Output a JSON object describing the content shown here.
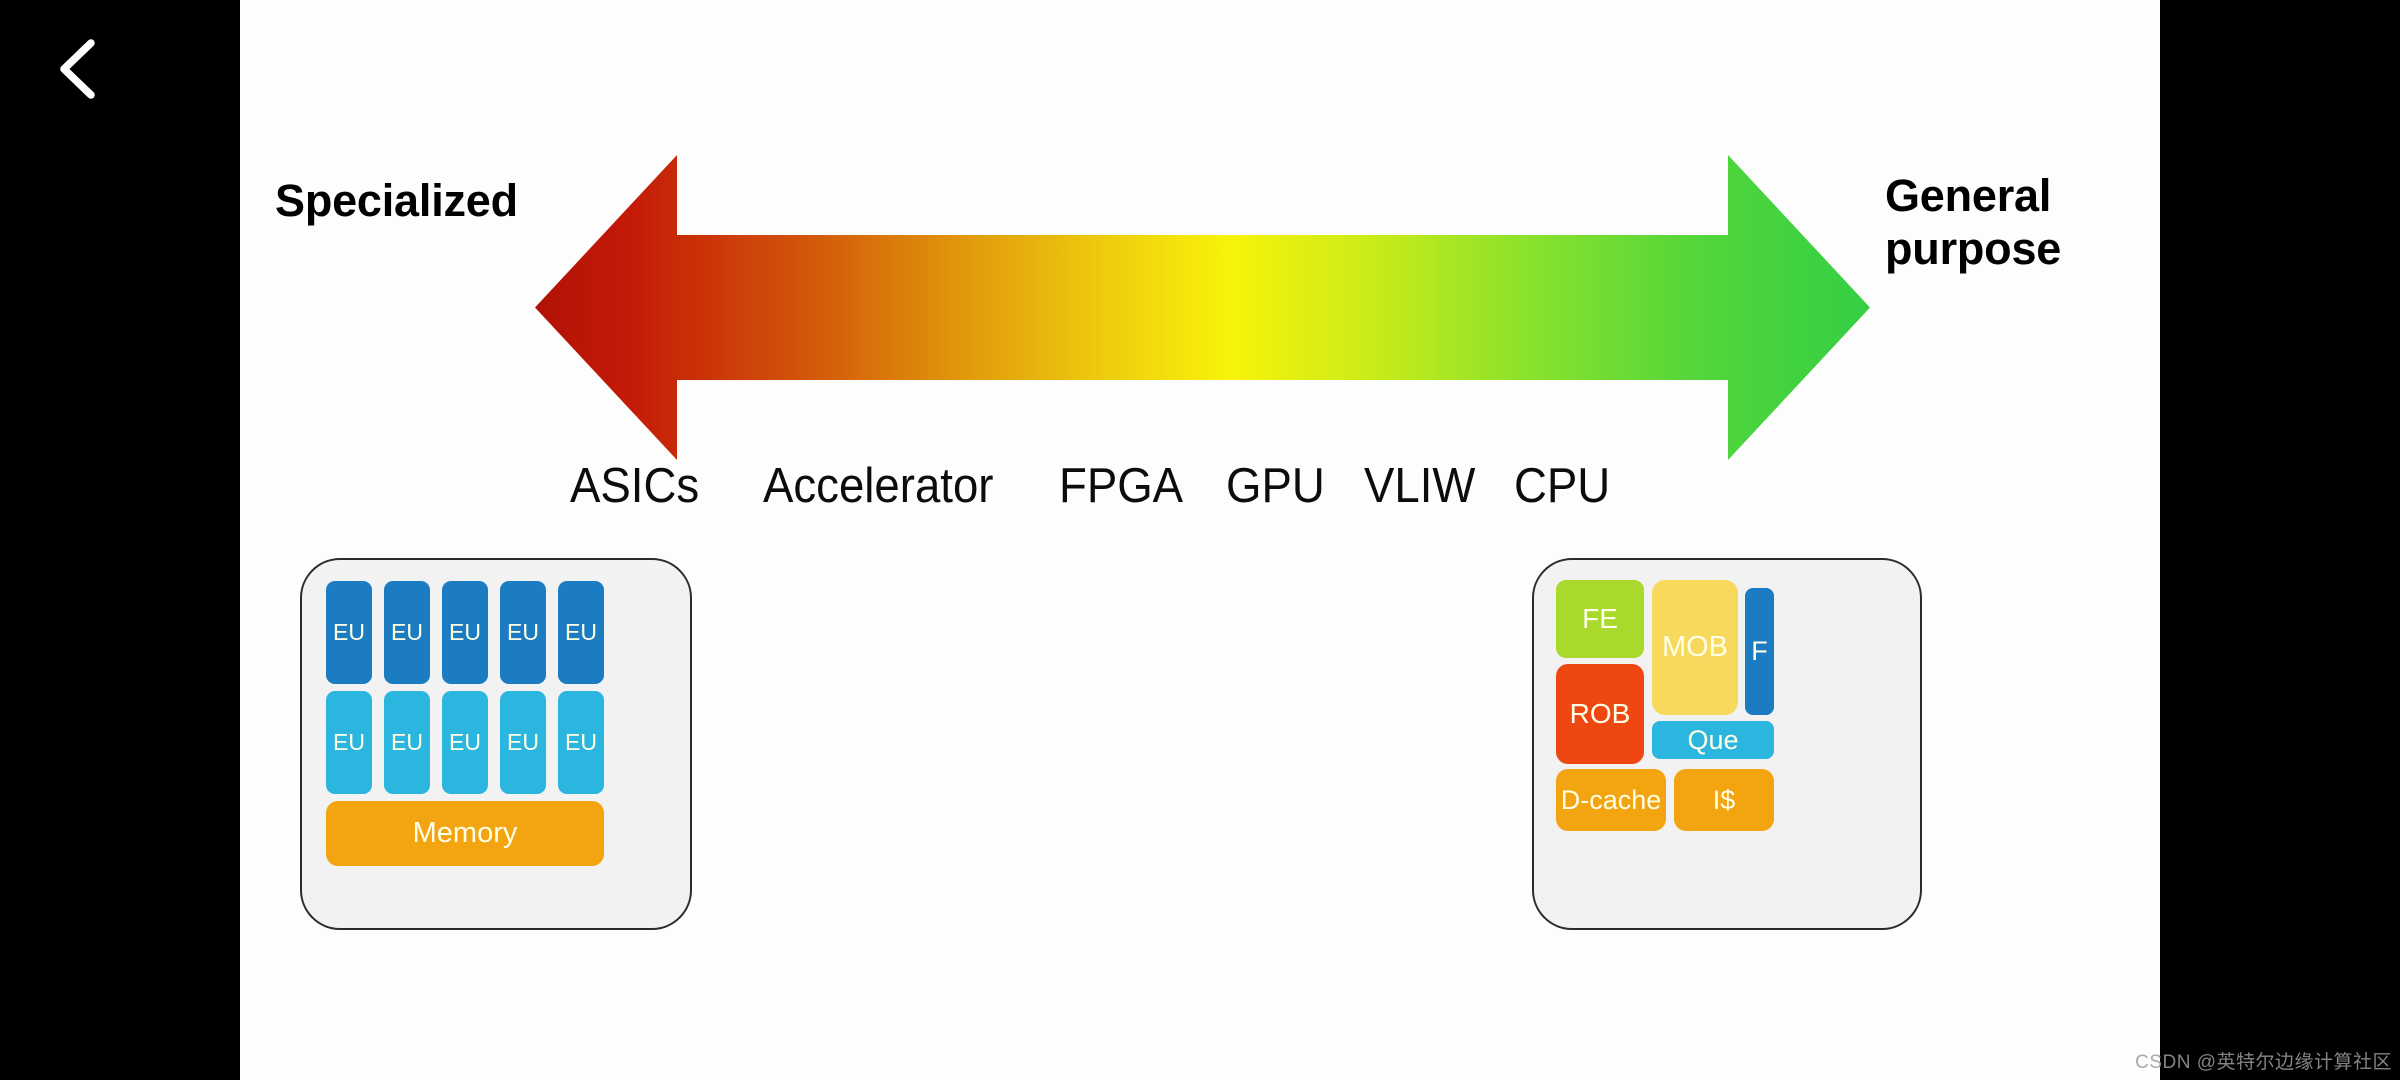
{
  "player": {
    "back_icon": "chevron-left-icon"
  },
  "slide": {
    "axis": {
      "left_label": "Specialized",
      "right_label": "General\npurpose",
      "right_label_line1": "General",
      "right_label_line2": "purpose",
      "arrow_icon": "double-headed-arrow-icon",
      "gradient_stops": [
        "#b01205",
        "#c91f06",
        "#d9560a",
        "#e5a10c",
        "#f2d60e",
        "#f8f30a",
        "#c4ea1c",
        "#86e02e",
        "#4fd53b",
        "#34ce44"
      ]
    },
    "devices": [
      {
        "label": "ASICs"
      },
      {
        "label": "Accelerator"
      },
      {
        "label": "FPGA"
      },
      {
        "label": "GPU"
      },
      {
        "label": "VLIW"
      },
      {
        "label": "CPU"
      }
    ],
    "specialized_chip": {
      "name": "specialized-accelerator-diagram",
      "eu_top": [
        {
          "label": "EU",
          "color": "#1b7cc2"
        },
        {
          "label": "EU",
          "color": "#1b7cc2"
        },
        {
          "label": "EU",
          "color": "#1b7cc2"
        },
        {
          "label": "EU",
          "color": "#1b7cc2"
        },
        {
          "label": "EU",
          "color": "#1b7cc2"
        }
      ],
      "eu_bottom": [
        {
          "label": "EU",
          "color": "#2bb6e0"
        },
        {
          "label": "EU",
          "color": "#2bb6e0"
        },
        {
          "label": "EU",
          "color": "#2bb6e0"
        },
        {
          "label": "EU",
          "color": "#2bb6e0"
        },
        {
          "label": "EU",
          "color": "#2bb6e0"
        }
      ],
      "memory": {
        "label": "Memory",
        "color": "#f3a411"
      }
    },
    "general_chip": {
      "name": "general-purpose-cpu-diagram",
      "blocks": {
        "fe": {
          "label": "FE",
          "color": "#a8d92c"
        },
        "rob": {
          "label": "ROB",
          "color": "#ee4712"
        },
        "mob": {
          "label": "MOB",
          "color": "#f7d95e"
        },
        "f": {
          "label": "F",
          "color": "#1b7cc2"
        },
        "que": {
          "label": "Que",
          "color": "#2bb6e0"
        },
        "dcache": {
          "label": "D-cache",
          "color": "#f3a411"
        },
        "is": {
          "label": "I$",
          "color": "#f3a411"
        }
      }
    }
  },
  "watermark": {
    "text": "CSDN @英特尔边缘计算社区"
  }
}
